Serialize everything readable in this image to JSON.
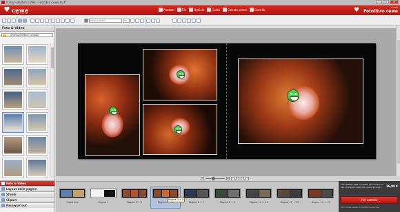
{
  "window": {
    "title": "Il mio Fotolibro CEWE - Fotolibro Cewe.mcf*",
    "controls": [
      "–",
      "□",
      "✕"
    ]
  },
  "header": {
    "brand": "cewe",
    "tagline": "best in print",
    "menu": [
      {
        "label": "Prodotti",
        "icon": "products-icon"
      },
      {
        "label": "File",
        "icon": "file-icon"
      },
      {
        "label": "Opzioni",
        "icon": "options-icon"
      },
      {
        "label": "Guida",
        "icon": "help-icon"
      },
      {
        "label": "Calcola prezzi",
        "icon": "price-icon"
      },
      {
        "label": "Carrello",
        "icon": "cart-icon"
      }
    ],
    "product_small": "il mio",
    "product_name": "Fotolibro cewe"
  },
  "toolbar": {
    "font_dropdown": "Century Gothic",
    "size_dropdown": "12"
  },
  "left_panel": {
    "heading": "Foto & Video",
    "path": "...\\Immagini\\Mare (2)\\Ngn",
    "tabs": [
      {
        "label": "Foto & Video",
        "active": true
      },
      {
        "label": "Layout delle pagine",
        "active": false
      },
      {
        "label": "Sfondi",
        "active": false
      },
      {
        "label": "Clipart",
        "active": false
      },
      {
        "label": "Passepartout",
        "active": false
      }
    ]
  },
  "page_strip": {
    "pages": [
      {
        "label": "Copertina"
      },
      {
        "label": "Pagina 1"
      },
      {
        "label": "Pagina 2 + 3"
      },
      {
        "label": "Pagina 4 + 5"
      },
      {
        "label": "Pagina 6 + 7"
      },
      {
        "label": "Pagina 8 + 9"
      },
      {
        "label": "Pagina 10 + 11"
      },
      {
        "label": "Pagina 12 + 13"
      },
      {
        "label": "Pagina 14 + 15"
      }
    ],
    "selected_index": 3,
    "tooltip": "Pagina 4 + 5"
  },
  "cart": {
    "info": "FOTOLIBRO CEWE Compatto panoramico su carta fotografica satinata opaca (26 pag.)",
    "price": "26,99 €",
    "button": "Nel carrello",
    "note": "IVA inclusa, spese di spedizione escluse"
  },
  "colors": {
    "brand_red": "#c8102e",
    "smiley_green": "#4ad34a"
  }
}
